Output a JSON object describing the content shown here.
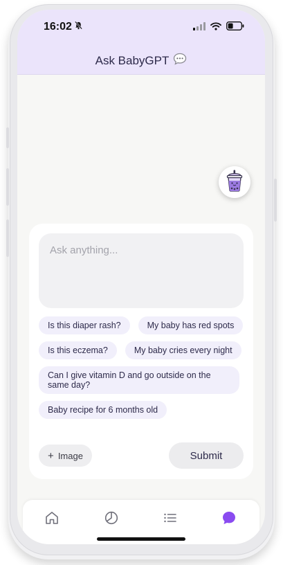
{
  "status_bar": {
    "time": "16:02"
  },
  "header": {
    "title": "Ask BabyGPT"
  },
  "floating_button": {
    "icon": "bubble-tea-icon"
  },
  "ask_box": {
    "placeholder": "Ask anything..."
  },
  "suggestions": [
    "Is this diaper rash?",
    "My baby has red spots",
    "Is this eczema?",
    "My baby cries every night",
    "Can I give vitamin D and go outside on the same day?",
    "Baby recipe for 6 months old"
  ],
  "actions": {
    "image_label": "Image",
    "image_prefix": "+",
    "submit_label": "Submit"
  },
  "tabs": [
    {
      "name": "home",
      "icon": "home-icon",
      "active": false
    },
    {
      "name": "stats",
      "icon": "pie-chart-icon",
      "active": false
    },
    {
      "name": "list",
      "icon": "list-icon",
      "active": false
    },
    {
      "name": "chat",
      "icon": "chat-bubble-icon",
      "active": true
    }
  ],
  "colors": {
    "accent": "#8a4bf0",
    "header_bg": "#ebe4fb",
    "chip_bg": "#f1effb",
    "title": "#2d2a4a"
  }
}
